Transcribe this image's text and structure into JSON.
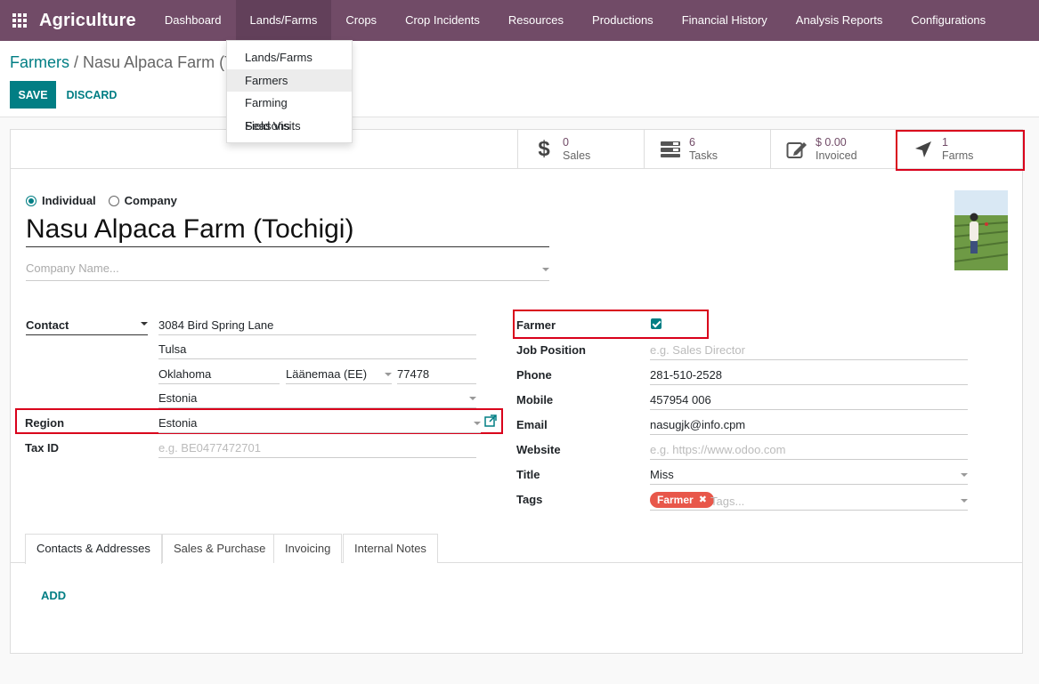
{
  "app": {
    "name": "Agriculture"
  },
  "nav": {
    "items": [
      "Dashboard",
      "Lands/Farms",
      "Crops",
      "Crop Incidents",
      "Resources",
      "Productions",
      "Financial History",
      "Analysis Reports",
      "Configurations"
    ],
    "active": "Lands/Farms"
  },
  "dropdown": {
    "items": [
      "Lands/Farms",
      "Farmers",
      "Farming Seasons",
      "Field Visits"
    ],
    "highlighted": "Farmers"
  },
  "breadcrumb": {
    "parent": "Farmers",
    "separator": "/",
    "current": "Nasu Alpaca Farm (T"
  },
  "buttons": {
    "save": "SAVE",
    "discard": "DISCARD"
  },
  "stats": [
    {
      "value": "0",
      "label": "Sales",
      "icon": "dollar-icon"
    },
    {
      "value": "6",
      "label": "Tasks",
      "icon": "tasks-icon"
    },
    {
      "value": "$ 0.00",
      "label": "Invoiced",
      "icon": "edit-icon"
    },
    {
      "value": "1",
      "label": "Farms",
      "icon": "location-arrow-icon"
    }
  ],
  "partner_type": {
    "individual": "Individual",
    "company": "Company",
    "selected": "Individual"
  },
  "partner": {
    "name": "Nasu Alpaca Farm (Tochigi)",
    "company_placeholder": "Company Name..."
  },
  "address": {
    "type": "Contact",
    "street": "3084 Bird Spring Lane",
    "city": "Tulsa",
    "state_text": "Oklahoma",
    "state_select": "Läänemaa (EE)",
    "zip": "77478",
    "country": "Estonia"
  },
  "region": {
    "label": "Region",
    "value": "Estonia"
  },
  "tax_id": {
    "label": "Tax ID",
    "placeholder": "e.g. BE0477472701"
  },
  "right_fields": {
    "farmer": {
      "label": "Farmer",
      "checked": true
    },
    "job_position": {
      "label": "Job Position",
      "placeholder": "e.g. Sales Director"
    },
    "phone": {
      "label": "Phone",
      "value": "281-510-2528"
    },
    "mobile": {
      "label": "Mobile",
      "value": "457954 006"
    },
    "email": {
      "label": "Email",
      "value": "nasugjk@info.cpm"
    },
    "website": {
      "label": "Website",
      "placeholder": "e.g. https://www.odoo.com"
    },
    "title": {
      "label": "Title",
      "value": "Miss"
    },
    "tags": {
      "label": "Tags",
      "items": [
        "Farmer"
      ],
      "placeholder": "Tags..."
    }
  },
  "tabs": [
    "Contacts & Addresses",
    "Sales & Purchase",
    "Invoicing",
    "Internal Notes"
  ],
  "active_tab": "Contacts & Addresses",
  "add_label": "ADD",
  "colors": {
    "primary": "#714b67",
    "accent": "#017e84",
    "highlight": "#d9001b",
    "tag": "#e8574a"
  }
}
